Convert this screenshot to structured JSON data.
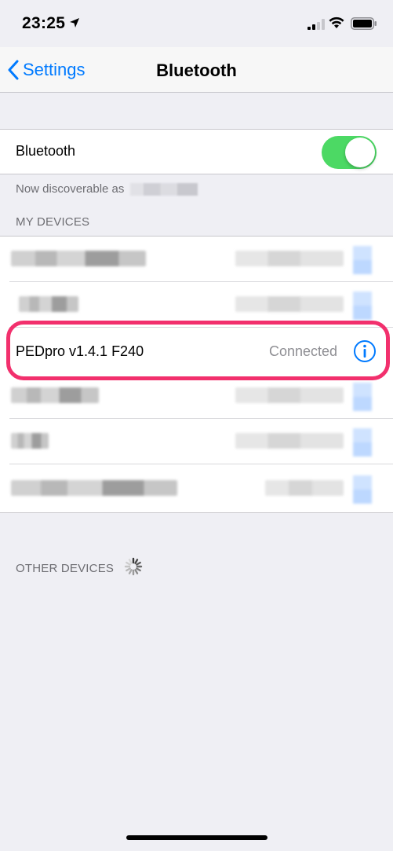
{
  "status_bar": {
    "time": "23:25",
    "icons": [
      "location-arrow-icon",
      "cellular-signal-icon",
      "wifi-icon",
      "battery-icon"
    ]
  },
  "nav": {
    "back_label": "Settings",
    "title": "Bluetooth"
  },
  "bluetooth": {
    "label": "Bluetooth",
    "enabled": true,
    "discoverable_text": "Now discoverable as"
  },
  "sections": {
    "my_devices": "MY DEVICES",
    "other_devices": "OTHER DEVICES"
  },
  "devices": [
    {
      "name": "",
      "status": "",
      "obscured": true
    },
    {
      "name": "",
      "status": "",
      "obscured": true
    },
    {
      "name": "PEDpro v1.4.1 F240",
      "status": "Connected",
      "obscured": false,
      "highlighted": true
    },
    {
      "name": "",
      "status": "",
      "obscured": true
    },
    {
      "name": "",
      "status": "",
      "obscured": true
    },
    {
      "name": "",
      "status": "",
      "obscured": true
    }
  ],
  "colors": {
    "accent": "#007aff",
    "toggle_on": "#4cd964",
    "highlight": "#f2306d",
    "background": "#efeff4"
  }
}
